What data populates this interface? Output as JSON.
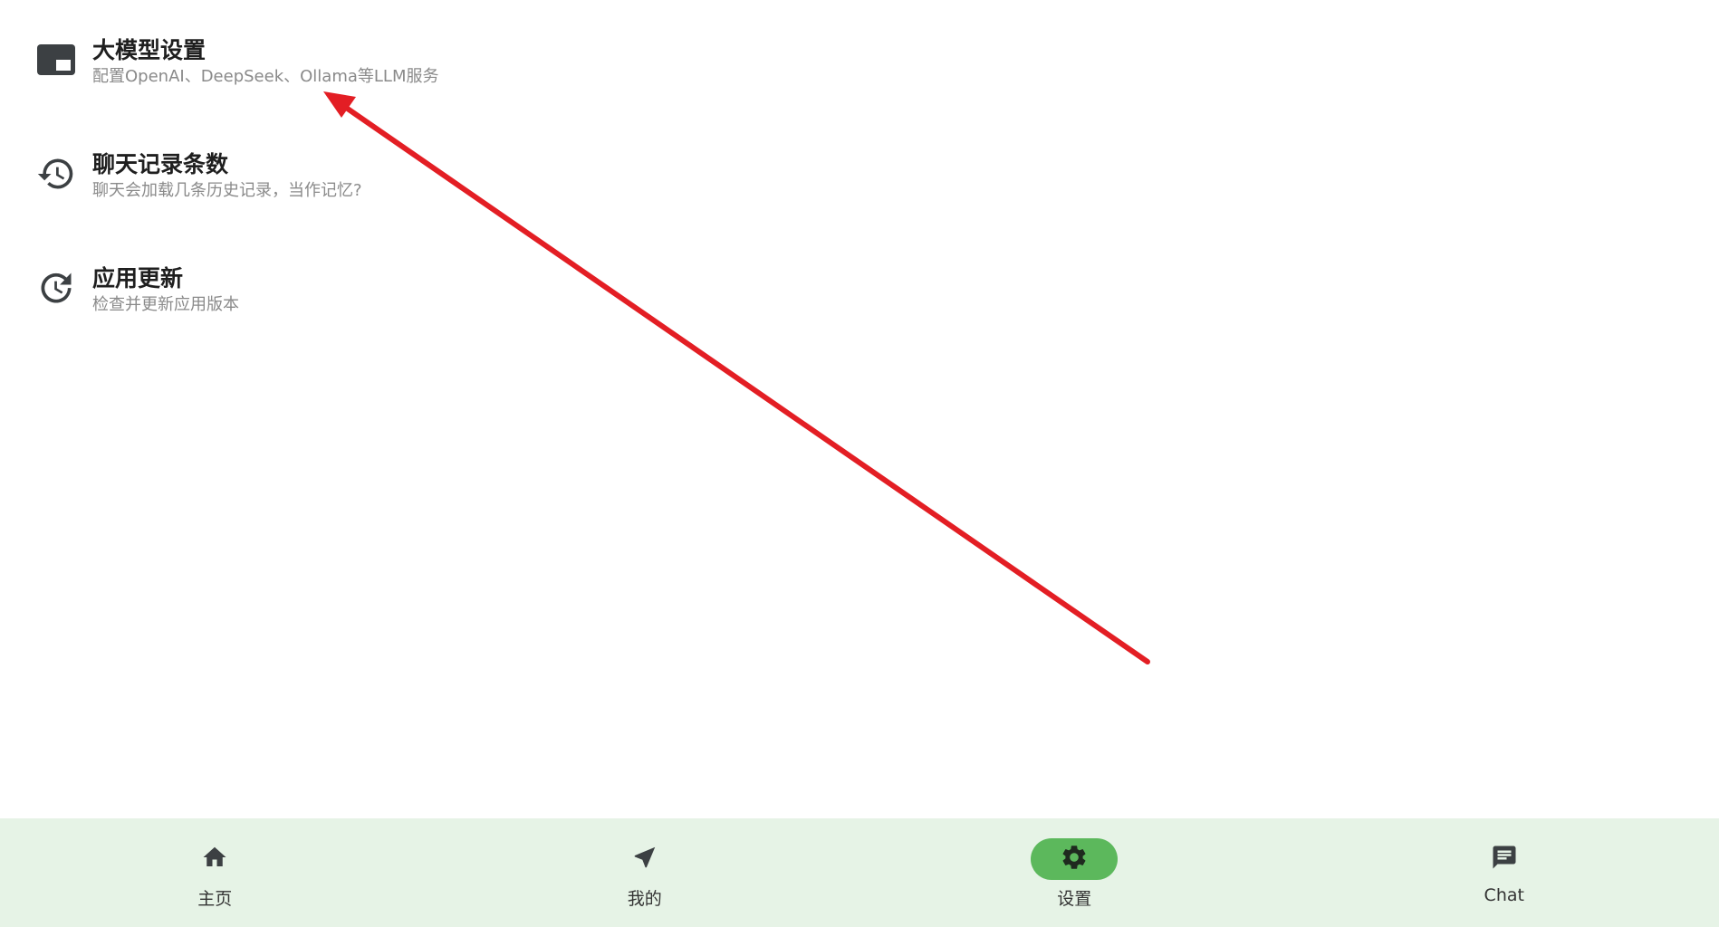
{
  "settings": {
    "items": [
      {
        "title": "大模型设置",
        "subtitle": "配置OpenAI、DeepSeek、Ollama等LLM服务",
        "icon": "picture-in-picture-icon"
      },
      {
        "title": "聊天记录条数",
        "subtitle": "聊天会加载几条历史记录，当作记忆?",
        "icon": "history-icon"
      },
      {
        "title": "应用更新",
        "subtitle": "检查并更新应用版本",
        "icon": "update-icon"
      }
    ]
  },
  "bottom_nav": {
    "items": [
      {
        "label": "主页",
        "icon": "home-icon",
        "active": false
      },
      {
        "label": "我的",
        "icon": "navigation-icon",
        "active": false
      },
      {
        "label": "设置",
        "icon": "gear-icon",
        "active": true
      },
      {
        "label": "Chat",
        "icon": "chat-icon",
        "active": false
      }
    ]
  },
  "colors": {
    "accent": "#5cb85c",
    "nav_background": "#e6f3e6",
    "annotation_arrow": "#e31e24",
    "subtitle": "#8a8a8a",
    "icon": "#3c4043"
  }
}
